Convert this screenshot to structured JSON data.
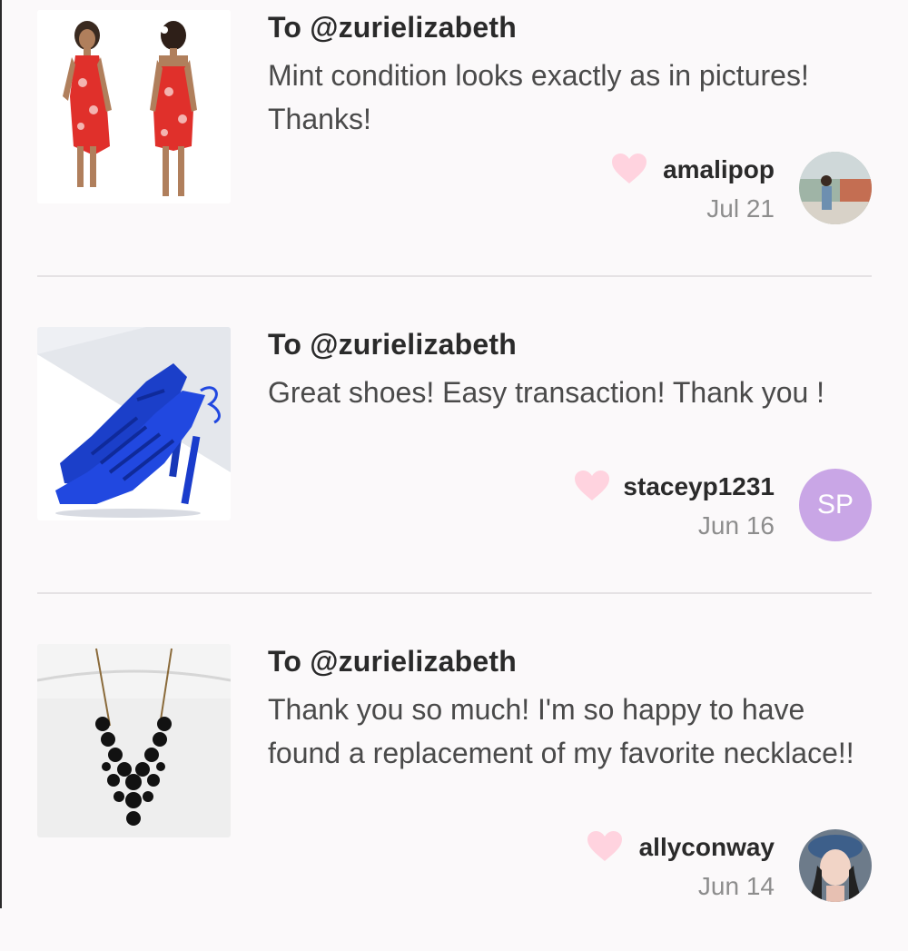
{
  "colors": {
    "background": "#fbf9fa",
    "heart": "#ffd3df",
    "sp_avatar": "#c9a6e6",
    "date": "#8d8d8d",
    "divider": "#e5e2e4"
  },
  "reviews": [
    {
      "recipient": "To @zurielizabeth",
      "comment": "Mint condition looks exactly as in pictures! Thanks!",
      "username": "amalipop",
      "date": "Jul 21",
      "thumbnail": "red-floral-sarong-dress-image",
      "avatar": "photo"
    },
    {
      "recipient": "To @zurielizabeth",
      "comment": "Great shoes! Easy transaction! Thank you !",
      "username": "staceyp1231",
      "date": "Jun 16",
      "thumbnail": "blue-strappy-heels-image",
      "avatar_initials": "SP"
    },
    {
      "recipient": "To @zurielizabeth",
      "comment": "Thank you so much! I'm so happy to have found a replacement of my favorite necklace!!",
      "username": "allyconway",
      "date": "Jun 14",
      "thumbnail": "black-bubble-necklace-image",
      "avatar": "photo"
    }
  ]
}
